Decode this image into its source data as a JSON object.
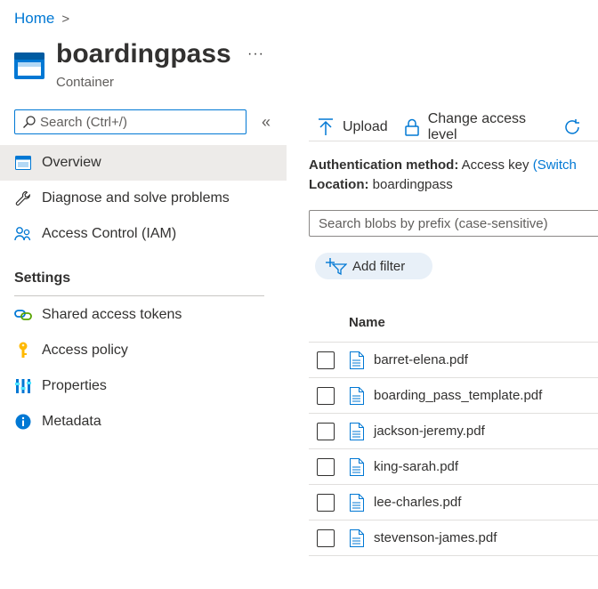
{
  "breadcrumb": {
    "home": "Home",
    "separator": ">"
  },
  "header": {
    "title": "boardingpass",
    "subtitle": "Container",
    "more": "···",
    "icon": "storage-container-icon"
  },
  "sidebar": {
    "search_placeholder": "Search (Ctrl+/)",
    "collapse": "«",
    "items": [
      {
        "label": "Overview",
        "icon": "overview-icon",
        "active": true
      },
      {
        "label": "Diagnose and solve problems",
        "icon": "wrench-icon"
      },
      {
        "label": "Access Control (IAM)",
        "icon": "people-icon"
      }
    ],
    "settings_heading": "Settings",
    "settings_items": [
      {
        "label": "Shared access tokens",
        "icon": "link-icon"
      },
      {
        "label": "Access policy",
        "icon": "key-icon"
      },
      {
        "label": "Properties",
        "icon": "properties-icon"
      },
      {
        "label": "Metadata",
        "icon": "info-icon"
      }
    ]
  },
  "toolbar": {
    "upload": "Upload",
    "change_access": "Change access level"
  },
  "info": {
    "auth_label": "Authentication method:",
    "auth_value": "Access key",
    "auth_link": "(Switch",
    "location_label": "Location:",
    "location_value": "boardingpass"
  },
  "blob_search_placeholder": "Search blobs by prefix (case-sensitive)",
  "add_filter": "Add filter",
  "table": {
    "column_name": "Name",
    "rows": [
      "barret-elena.pdf",
      "boarding_pass_template.pdf",
      "jackson-jeremy.pdf",
      "king-sarah.pdf",
      "lee-charles.pdf",
      "stevenson-james.pdf"
    ]
  },
  "colors": {
    "accent": "#0078d4",
    "active_bg": "#edebe9",
    "pill_bg": "#e8f0f8"
  }
}
